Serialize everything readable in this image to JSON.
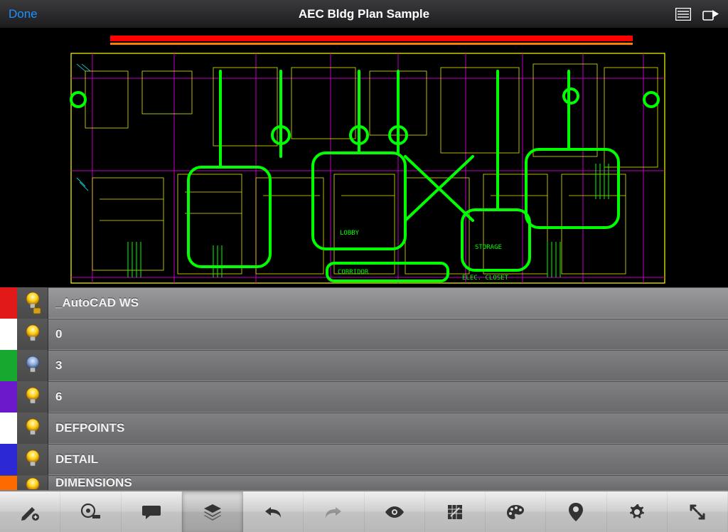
{
  "header": {
    "done_label": "Done",
    "title": "AEC Bldg Plan Sample"
  },
  "canvas": {
    "labels": {
      "lobby": "LOBBY",
      "corridor": "CORRIDOR",
      "storage": "STORAGE",
      "elec_closet": "ELEC. CLOSET"
    }
  },
  "layers": [
    {
      "name": "_AutoCAD WS",
      "color": "#e11919",
      "bulb": "on",
      "locked": true
    },
    {
      "name": "0",
      "color": "#ffffff",
      "bulb": "on",
      "locked": false
    },
    {
      "name": "3",
      "color": "#17a82f",
      "bulb": "off",
      "locked": false
    },
    {
      "name": "6",
      "color": "#6a18c9",
      "bulb": "on",
      "locked": false
    },
    {
      "name": "DEFPOINTS",
      "color": "#ffffff",
      "bulb": "on",
      "locked": false
    },
    {
      "name": "DETAIL",
      "color": "#2d28d6",
      "bulb": "on",
      "locked": false
    },
    {
      "name": "DIMENSIONS",
      "color": "#ff6a00",
      "bulb": "on",
      "locked": false
    }
  ],
  "toolbar": {
    "tools": [
      {
        "id": "draw",
        "active": false,
        "disabled": false
      },
      {
        "id": "measure",
        "active": false,
        "disabled": false
      },
      {
        "id": "comment",
        "active": false,
        "disabled": false
      },
      {
        "id": "layers",
        "active": true,
        "disabled": false
      },
      {
        "id": "undo",
        "active": false,
        "disabled": false
      },
      {
        "id": "redo",
        "active": false,
        "disabled": true
      },
      {
        "id": "view",
        "active": false,
        "disabled": false
      },
      {
        "id": "snap",
        "active": false,
        "disabled": false
      },
      {
        "id": "palette",
        "active": false,
        "disabled": false
      },
      {
        "id": "location",
        "active": false,
        "disabled": false
      },
      {
        "id": "settings",
        "active": false,
        "disabled": false
      },
      {
        "id": "fullscreen",
        "active": false,
        "disabled": false
      }
    ]
  },
  "colors": {
    "header_link": "#1e90ff",
    "floor_green": "#00ff00",
    "floor_yellow": "#ffff00",
    "floor_magenta": "#c300c3",
    "floor_red": "#ff0000",
    "floor_cyan": "#00ffff",
    "floor_orange": "#ff7f00"
  }
}
